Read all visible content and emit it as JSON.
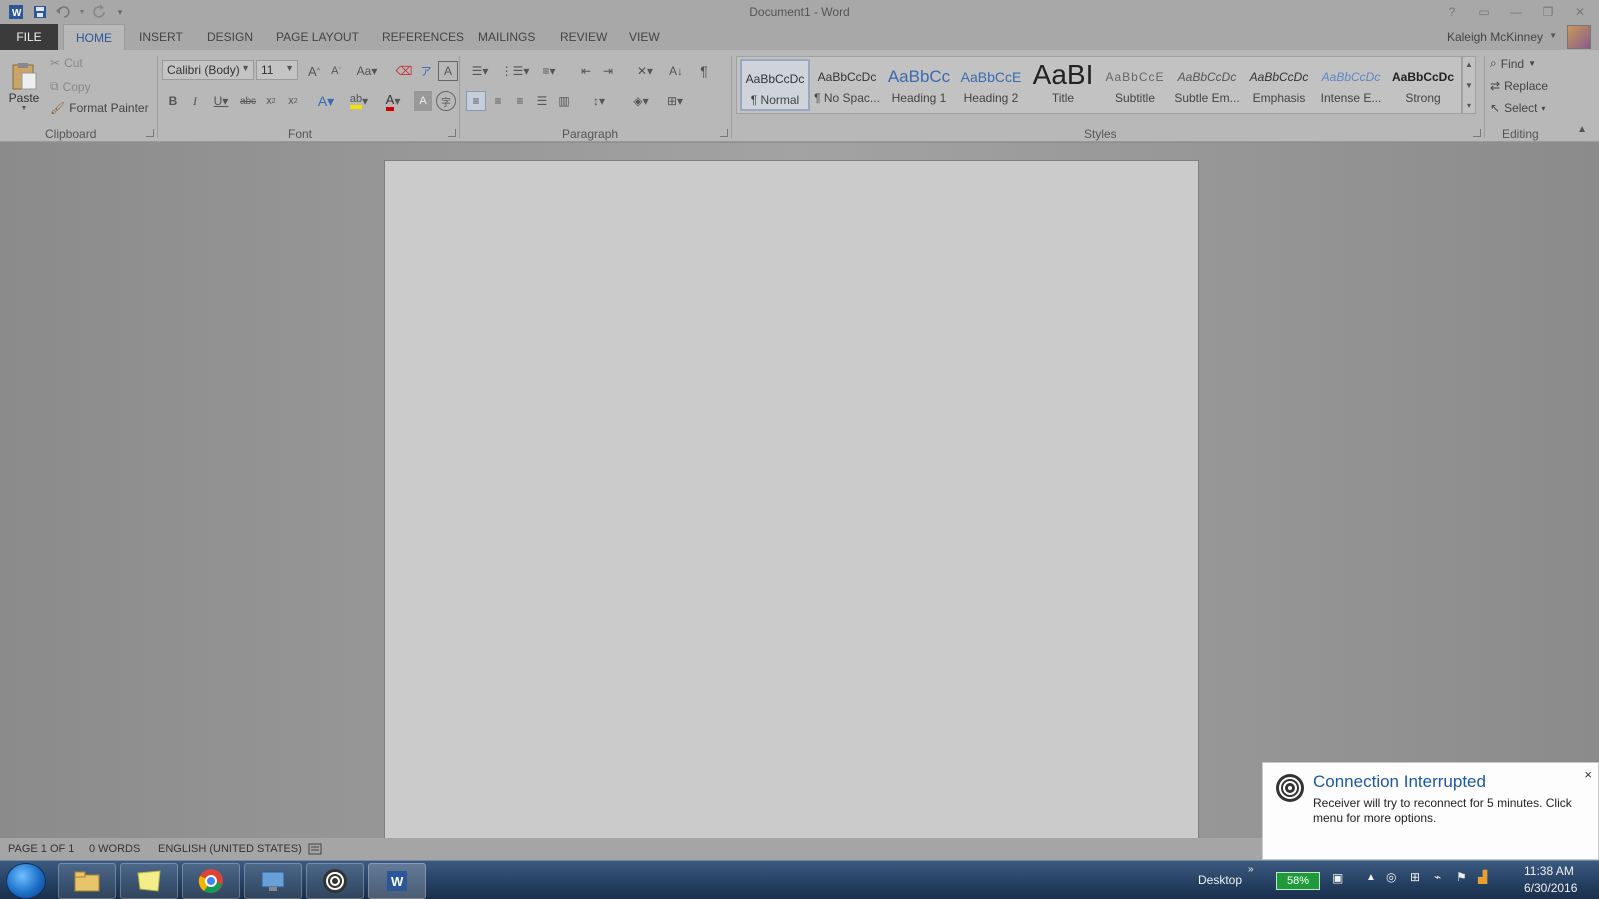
{
  "window": {
    "title": "Document1 - Word",
    "controls": [
      "?",
      "▭",
      "—",
      "❐",
      "✕"
    ]
  },
  "tabs": [
    "FILE",
    "HOME",
    "INSERT",
    "DESIGN",
    "PAGE LAYOUT",
    "REFERENCES",
    "MAILINGS",
    "REVIEW",
    "VIEW"
  ],
  "active_tab": "HOME",
  "user": {
    "name": "Kaleigh McKinney"
  },
  "clipboard": {
    "label": "Clipboard",
    "paste": "Paste",
    "cut": "Cut",
    "copy": "Copy",
    "format_painter": "Format Painter"
  },
  "font": {
    "label": "Font",
    "family": "Calibri (Body)",
    "size": "11"
  },
  "paragraph": {
    "label": "Paragraph"
  },
  "styles": {
    "label": "Styles",
    "items": [
      {
        "sample": "AaBbCcDc",
        "name": "¶ Normal"
      },
      {
        "sample": "AaBbCcDc",
        "name": "¶ No Spac..."
      },
      {
        "sample": "AaBbCc",
        "name": "Heading 1"
      },
      {
        "sample": "AaBbCcE",
        "name": "Heading 2"
      },
      {
        "sample": "AaBI",
        "name": "Title"
      },
      {
        "sample": "AaBbCcE",
        "name": "Subtitle"
      },
      {
        "sample": "AaBbCcDc",
        "name": "Subtle Em..."
      },
      {
        "sample": "AaBbCcDc",
        "name": "Emphasis"
      },
      {
        "sample": "AaBbCcDc",
        "name": "Intense E..."
      },
      {
        "sample": "AaBbCcDc",
        "name": "Strong"
      }
    ],
    "selected": "¶ Normal"
  },
  "editing": {
    "label": "Editing",
    "find": "Find",
    "replace": "Replace",
    "select": "Select"
  },
  "status": {
    "page": "PAGE 1 OF 1",
    "words": "0 WORDS",
    "language": "ENGLISH (UNITED STATES)"
  },
  "notification": {
    "title": "Connection Interrupted",
    "body": "Receiver will try to reconnect for 5 minutes.  Click menu for more options.",
    "close": "×"
  },
  "taskbar": {
    "desktop_label": "Desktop",
    "battery": "58%",
    "time": "11:38 AM",
    "date": "6/30/2016",
    "apps": [
      "explorer-icon",
      "sticky-notes-icon",
      "chrome-icon",
      "remote-desktop-icon",
      "citrix-receiver-icon",
      "word-icon"
    ]
  },
  "colors": {
    "accent": "#2b579a",
    "file_tab": "#3b3b3b",
    "font_color_bar": "#d00000",
    "highlight_bar": "#f2e200",
    "notification_title": "#1c58a6"
  }
}
